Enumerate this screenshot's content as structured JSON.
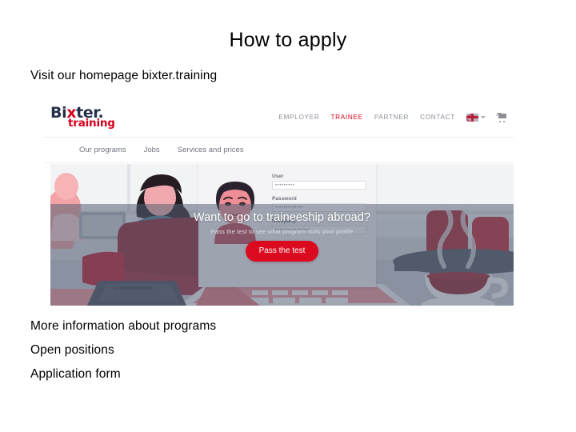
{
  "slide": {
    "title": "How to apply",
    "lead": "Visit our homepage bixter.training",
    "links": [
      "More information about programs",
      "Open positions",
      "Application form"
    ]
  },
  "website": {
    "logo": {
      "main_before": "Bi",
      "main_x": "x",
      "main_after": "ter.",
      "sub": "training"
    },
    "main_nav": [
      {
        "label": "EMPLOYER",
        "active": false
      },
      {
        "label": "TRAINEE",
        "active": true
      },
      {
        "label": "PARTNER",
        "active": false
      },
      {
        "label": "CONTACT",
        "active": false
      }
    ],
    "language": {
      "flag": "uk-flag-icon",
      "chevron": "chevron-down-icon"
    },
    "cart": "shopping-cart-icon",
    "sub_nav": [
      "Our programs",
      "Jobs",
      "Services and prices"
    ],
    "login_card": {
      "avatar": "user-avatar-illustration",
      "fields": [
        {
          "label": "User",
          "value": "•••••••••"
        },
        {
          "label": "Password",
          "value": "•••••••••••••"
        },
        {
          "label": "Company",
          "value": "••••••••••••••••"
        }
      ]
    },
    "hero": {
      "heading": "Want to go to traineeship abroad?",
      "subheading": "Pass the test to see what program suits your profile",
      "cta": "Pass the test"
    }
  },
  "colors": {
    "brand_red": "#d6001c",
    "brand_navy": "#24304a",
    "cta_red": "#dc0a1e",
    "overlay": "rgba(86,96,116,0.55)"
  }
}
